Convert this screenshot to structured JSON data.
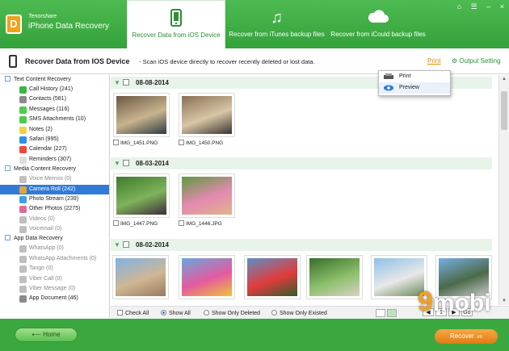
{
  "app": {
    "brand_top": "Tenorshare",
    "brand_name": "iPhone Data Recovery",
    "logo_letter": "D"
  },
  "tabs": [
    {
      "label": "Recover Data from iOS Device",
      "icon": "phone-icon",
      "active": true
    },
    {
      "label": "Recover from iTunes backup files",
      "icon": "music-icon",
      "active": false
    },
    {
      "label": "Recover from iCould backup files",
      "icon": "cloud-icon",
      "active": false
    }
  ],
  "window_controls": {
    "home": "⌂",
    "menu": "☰",
    "minimize": "–",
    "close": "×"
  },
  "subheader": {
    "title": "Recover Data from IOS Device",
    "description": "- Scan iOS device directly to recover recently deleted or lost data.",
    "print": "Print",
    "output_setting": "Output Setting"
  },
  "print_menu": {
    "items": [
      "Print",
      "Preview"
    ]
  },
  "sidebar": {
    "categories": [
      {
        "label": "Text Content Recovery",
        "items": [
          {
            "label": "Call History (241)",
            "color": "#3bb54a",
            "disabled": false
          },
          {
            "label": "Contacts (581)",
            "color": "#8a8a8a",
            "disabled": false
          },
          {
            "label": "Messages (116)",
            "color": "#4ccb4c",
            "disabled": false
          },
          {
            "label": "SMS Attachments (10)",
            "color": "#4ccb4c",
            "disabled": false
          },
          {
            "label": "Notes (2)",
            "color": "#f3d24a",
            "disabled": false
          },
          {
            "label": "Safari (995)",
            "color": "#2f8fe0",
            "disabled": false
          },
          {
            "label": "Calendar (227)",
            "color": "#e94a3a",
            "disabled": false
          },
          {
            "label": "Reminders (307)",
            "color": "#dddddd",
            "disabled": false
          }
        ]
      },
      {
        "label": "Media Content Recovery",
        "items": [
          {
            "label": "Voice Memos (0)",
            "color": "#bfbfbf",
            "disabled": true
          },
          {
            "label": "Camera Roll (242)",
            "color": "#e8a23a",
            "disabled": false,
            "selected": true
          },
          {
            "label": "Photo Stream (239)",
            "color": "#3aa0e0",
            "disabled": false
          },
          {
            "label": "Other Photos (2275)",
            "color": "#e06a9a",
            "disabled": false
          },
          {
            "label": "Videos (0)",
            "color": "#bfbfbf",
            "disabled": true
          },
          {
            "label": "Voicemail (0)",
            "color": "#bfbfbf",
            "disabled": true
          }
        ]
      },
      {
        "label": "App Data Recovery",
        "items": [
          {
            "label": "WhatsApp (0)",
            "color": "#bfbfbf",
            "disabled": true
          },
          {
            "label": "WhatsApp Attachments (0)",
            "color": "#bfbfbf",
            "disabled": true
          },
          {
            "label": "Tango (0)",
            "color": "#bfbfbf",
            "disabled": true
          },
          {
            "label": "Viber Call (0)",
            "color": "#bfbfbf",
            "disabled": true
          },
          {
            "label": "Viber Message (0)",
            "color": "#bfbfbf",
            "disabled": true
          },
          {
            "label": "App Document (46)",
            "color": "#8a8a8a",
            "disabled": false
          }
        ]
      }
    ]
  },
  "groups": [
    {
      "date": "08-08-2014",
      "photos": [
        {
          "name": "IMG_1451.PNG",
          "colors": [
            "#6b5844",
            "#c9b48f",
            "#2f3a3e"
          ]
        },
        {
          "name": "IMG_1450.PNG",
          "colors": [
            "#8a6f55",
            "#d8c6a6",
            "#3a3430"
          ]
        }
      ]
    },
    {
      "date": "08-03-2014",
      "photos": [
        {
          "name": "IMG_1447.PNG",
          "colors": [
            "#3f7a2e",
            "#7fb35a",
            "#3b2d3a"
          ]
        },
        {
          "name": "IMG_1446.JPG",
          "colors": [
            "#5f9a3f",
            "#e48ab0",
            "#dfb48b"
          ]
        }
      ]
    },
    {
      "date": "08-02-2014",
      "photos": [
        {
          "name": "",
          "colors": [
            "#7fb2e3",
            "#cfb796",
            "#9a7a5a"
          ]
        },
        {
          "name": "",
          "colors": [
            "#6aa7da",
            "#e45aa0",
            "#f0c23a"
          ]
        },
        {
          "name": "",
          "colors": [
            "#5d8fc4",
            "#e23b3b",
            "#2f5c2b"
          ]
        },
        {
          "name": "",
          "colors": [
            "#3a6e2a",
            "#8bbf6a",
            "#d8d2c4"
          ]
        },
        {
          "name": "",
          "colors": [
            "#8fbfe8",
            "#e8e8e8",
            "#6a8a5a"
          ]
        },
        {
          "name": "",
          "colors": [
            "#7aaee0",
            "#4a6a4a",
            "#c9c9c9"
          ]
        }
      ]
    }
  ],
  "filters": {
    "check_all": "Check All",
    "show_all": "Show All",
    "show_deleted": "Show Only Deleted",
    "show_existed": "Show Only Existed"
  },
  "pager": {
    "first": "◀",
    "page": "1",
    "last": "▶",
    "go": "Go"
  },
  "footer": {
    "home": "Home",
    "recover": "Recover"
  },
  "watermark": {
    "nine": "9",
    "text": "mobi",
    "suffix": ".vn"
  }
}
